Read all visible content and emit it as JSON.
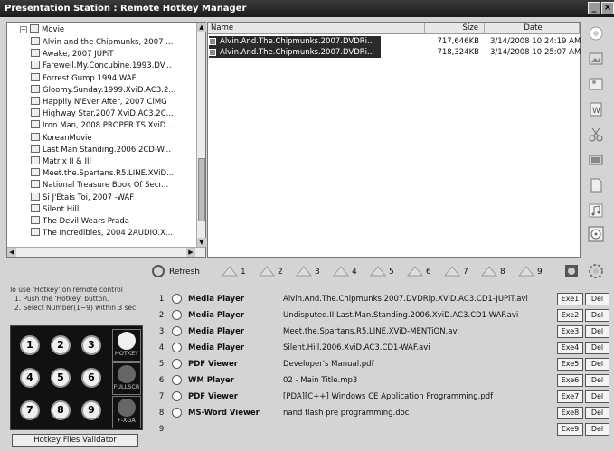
{
  "window": {
    "title": "Presentation Station : Remote Hotkey Manager"
  },
  "tree": {
    "root": "Movie",
    "items": [
      "Alvin and the Chipmunks, 2007 ...",
      "Awake, 2007 JUPiT",
      "Farewell.My.Concubine.1993.DV...",
      "Forrest Gump 1994 WAF",
      "Gloomy.Sunday.1999.XviD.AC3.2...",
      "Happily N'Ever After, 2007 CiMG",
      "Highway Star.2007 XviD.AC3.2C...",
      "Iron Man, 2008 PROPER.TS.XviD...",
      "KoreanMovie",
      "Last Man Standing.2006 2CD-W...",
      "Matrix II & III",
      "Meet.the.Spartans.R5.LINE.XViD...",
      "National Treasure Book Of Secr...",
      "Si J'Etais Toi, 2007 -WAF",
      "Silent Hill",
      "The Devil Wears Prada",
      "The Incredibles, 2004 2AUDIO.X..."
    ]
  },
  "files": {
    "columns": {
      "name": "Name",
      "size": "Size",
      "date": "Date"
    },
    "rows": [
      {
        "name": "Alvin.And.The.Chipmunks.2007.DVDRi...",
        "size": "717,646KB",
        "date": "3/14/2008 10:24:19 AM"
      },
      {
        "name": "Alvin.And.The.Chipmunks.2007.DVDRi...",
        "size": "718,324KB",
        "date": "3/14/2008 10:25:07 AM"
      }
    ]
  },
  "toolbar": {
    "refresh_label": "Refresh",
    "hotkey_numbers": [
      "1",
      "2",
      "3",
      "4",
      "5",
      "6",
      "7",
      "8",
      "9"
    ]
  },
  "hint": {
    "line1": "To use 'Hotkey' on remote control",
    "line2": "1. Push the 'Hotkey' button.",
    "line3": "2. Select Number(1~9) within 3 sec"
  },
  "keypad": {
    "keys": [
      "1",
      "2",
      "3",
      "4",
      "5",
      "6",
      "7",
      "8",
      "9"
    ],
    "side_labels": [
      "HOTKEY",
      "FULLSCR",
      "F-XGA"
    ]
  },
  "validator_label": "Hotkey Files Validator",
  "hotkeys": [
    {
      "num": "1.",
      "app": "Media Player",
      "file": "Alvin.And.The.Chipmunks.2007.DVDRip.XViD.AC3.CD1-JUPiT.avi",
      "exe": "Exe1",
      "del": "Del",
      "icon": "media-player-icon"
    },
    {
      "num": "2.",
      "app": "Media Player",
      "file": "Undisputed.II.Last.Man.Standing.2006.XviD.AC3.CD1-WAF.avi",
      "exe": "Exe2",
      "del": "Del",
      "icon": "media-player-icon"
    },
    {
      "num": "3.",
      "app": "Media Player",
      "file": "Meet.the.Spartans.R5.LINE.XViD-MENTiON.avi",
      "exe": "Exe3",
      "del": "Del",
      "icon": "media-player-icon"
    },
    {
      "num": "4.",
      "app": "Media Player",
      "file": "Silent.Hill.2006.XviD.AC3.CD1-WAF.avi",
      "exe": "Exe4",
      "del": "Del",
      "icon": "media-player-icon"
    },
    {
      "num": "5.",
      "app": "PDF Viewer",
      "file": "Developer's Manual.pdf",
      "exe": "Exe5",
      "del": "Del",
      "icon": "pdf-icon"
    },
    {
      "num": "6.",
      "app": "WM Player",
      "file": "02 - Main Title.mp3",
      "exe": "Exe6",
      "del": "Del",
      "icon": "music-icon"
    },
    {
      "num": "7.",
      "app": "PDF Viewer",
      "file": "[PDA][C++] Windows CE Application Programming.pdf",
      "exe": "Exe7",
      "del": "Del",
      "icon": "pdf-icon"
    },
    {
      "num": "8.",
      "app": "MS-Word Viewer",
      "file": "nand flash pre programming.doc",
      "exe": "Exe8",
      "del": "Del",
      "icon": "word-icon"
    },
    {
      "num": "9.",
      "app": "",
      "file": "",
      "exe": "Exe9",
      "del": "Del",
      "icon": ""
    }
  ]
}
